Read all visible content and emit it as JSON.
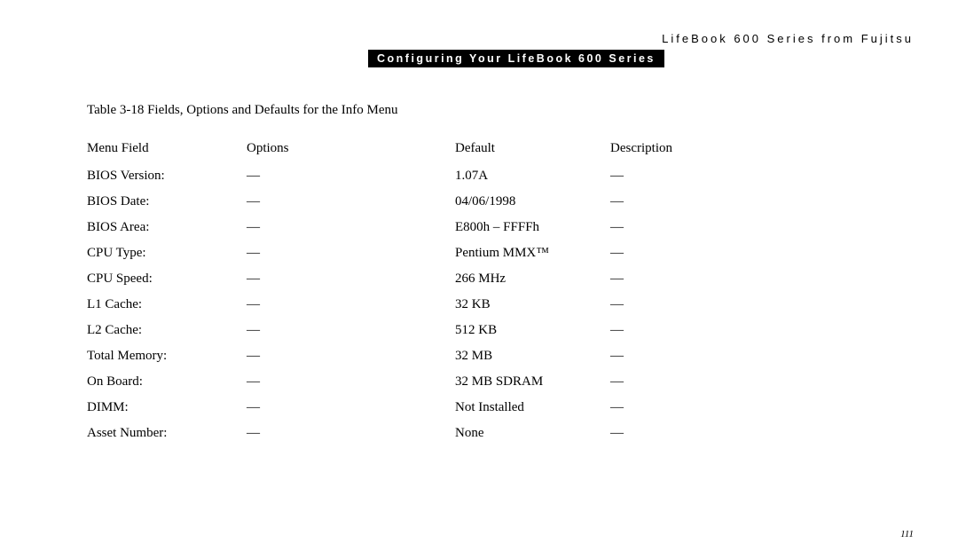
{
  "header_right": "LifeBook 600 Series from Fujitsu",
  "section_bar": "Configuring Your LifeBook 600 Series",
  "caption": "Table 3-18 Fields, Options and Defaults for the Info Menu",
  "columns": {
    "menu_field": "Menu Field",
    "options": "Options",
    "default": "Default",
    "description": "Description"
  },
  "rows": [
    {
      "field": "BIOS Version:",
      "options": "—",
      "default": "1.07A",
      "description": "—"
    },
    {
      "field": "BIOS Date:",
      "options": "—",
      "default": "04/06/1998",
      "description": "—"
    },
    {
      "field": "BIOS Area:",
      "options": "—",
      "default": "E800h – FFFFh",
      "description": "—"
    },
    {
      "field": "CPU Type:",
      "options": "—",
      "default": "Pentium MMX™",
      "description": "—"
    },
    {
      "field": "CPU Speed:",
      "options": "—",
      "default": "266 MHz",
      "description": "—"
    },
    {
      "field": "L1 Cache:",
      "options": "—",
      "default": "32 KB",
      "description": "—"
    },
    {
      "field": "L2 Cache:",
      "options": "—",
      "default": "512 KB",
      "description": "—"
    },
    {
      "field": "Total Memory:",
      "options": "—",
      "default": "32 MB",
      "description": "—"
    },
    {
      "field": "On Board:",
      "options": "—",
      "default": "32 MB SDRAM",
      "description": "—"
    },
    {
      "field": "DIMM:",
      "options": "—",
      "default": "Not Installed",
      "description": "—"
    },
    {
      "field": "Asset Number:",
      "options": "—",
      "default": "None",
      "description": "—"
    }
  ],
  "page_number": "111"
}
